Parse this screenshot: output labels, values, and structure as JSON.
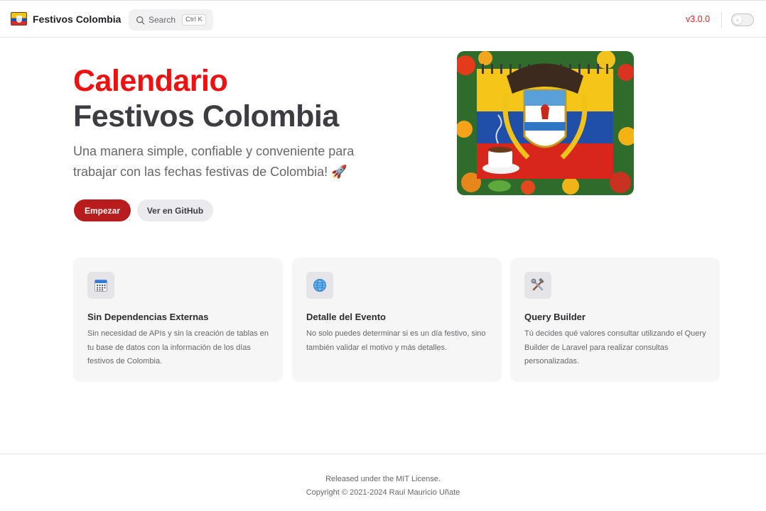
{
  "nav": {
    "title": "Festivos Colombia",
    "search_label": "Search",
    "search_kbd": "Ctrl K",
    "version": "v3.0.0"
  },
  "hero": {
    "name": "Calendario",
    "text": "Festivos Colombia",
    "tagline": "Una manera simple, confiable y conveniente para trabajar con las fechas festivas de Colombia! 🚀",
    "actions": [
      {
        "label": "Empezar"
      },
      {
        "label": "Ver en GitHub"
      }
    ]
  },
  "features": [
    {
      "icon": "calendar-icon",
      "title": "Sin Dependencias Externas",
      "details": "Sin necesidad de APIs y sin la creación de tablas en tu base de datos con la información de los días festivos de Colombia."
    },
    {
      "icon": "globe-icon",
      "title": "Detalle del Evento",
      "details": "No solo puedes determinar si es un día festivo, sino también validar el motivo y más detalles."
    },
    {
      "icon": "tools-icon",
      "title": "Query Builder",
      "details": "Tú decides qué valores consultar utilizando el Query Builder de Laravel para realizar consultas personalizadas."
    }
  ],
  "footer": {
    "message": "Released under the MIT License.",
    "copyright": "Copyright © 2021-2024 Raul Mauricio Uñate"
  },
  "colors": {
    "brand_red": "#ee1111",
    "button_red": "#b81d1d",
    "version_red": "#e02424"
  }
}
